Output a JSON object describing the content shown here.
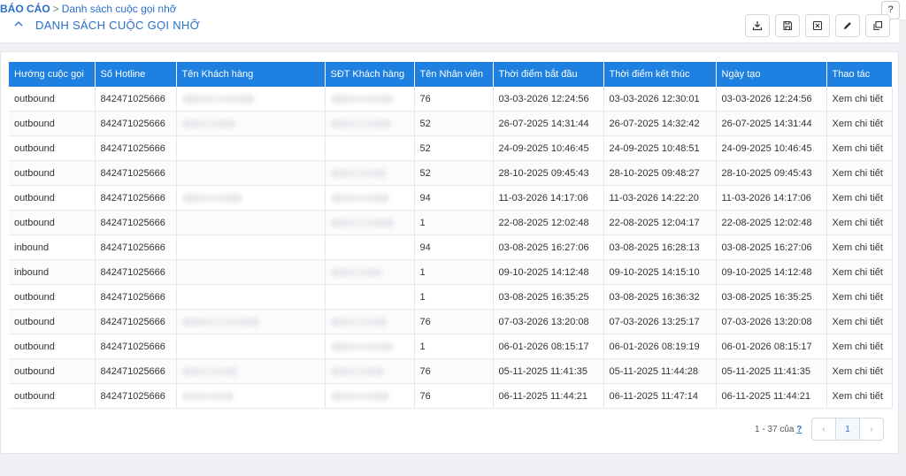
{
  "breadcrumb": {
    "root": "BÁO CÁO",
    "separator": ">",
    "current": "Danh sách cuộc gọi nhỡ"
  },
  "help": {
    "label": "?"
  },
  "section": {
    "title": "DANH SÁCH CUỘC GỌI NHỠ"
  },
  "toolbar": {
    "icons": [
      "download-icon",
      "save-icon",
      "excel-icon",
      "edit-icon",
      "copy-icon"
    ]
  },
  "table": {
    "columns": [
      "Hướng cuộc gọi",
      "Số Hotline",
      "Tên Khách hàng",
      "SĐT Khách hàng",
      "Tên Nhân viên",
      "Thời điểm bắt đầu",
      "Thời điểm kết thúc",
      "Ngày tạo",
      "Thao tác"
    ],
    "rows": [
      {
        "direction": "outbound",
        "hotline": "842471025666",
        "agent": "76",
        "start": "03-03-2026 12:24:56",
        "end": "03-03-2026 12:30:01",
        "created": "03-03-2026 12:24:56",
        "action": "Xem chi tiết"
      },
      {
        "direction": "outbound",
        "hotline": "842471025666",
        "agent": "52",
        "start": "26-07-2025 14:31:44",
        "end": "26-07-2025 14:32:42",
        "created": "26-07-2025 14:31:44",
        "action": "Xem chi tiết"
      },
      {
        "direction": "outbound",
        "hotline": "842471025666",
        "agent": "52",
        "start": "24-09-2025 10:46:45",
        "end": "24-09-2025 10:48:51",
        "created": "24-09-2025 10:46:45",
        "action": "Xem chi tiết"
      },
      {
        "direction": "outbound",
        "hotline": "842471025666",
        "agent": "52",
        "start": "28-10-2025 09:45:43",
        "end": "28-10-2025 09:48:27",
        "created": "28-10-2025 09:45:43",
        "action": "Xem chi tiết"
      },
      {
        "direction": "outbound",
        "hotline": "842471025666",
        "agent": "94",
        "start": "11-03-2026 14:17:06",
        "end": "11-03-2026 14:22:20",
        "created": "11-03-2026 14:17:06",
        "action": "Xem chi tiết"
      },
      {
        "direction": "outbound",
        "hotline": "842471025666",
        "agent": "1",
        "start": "22-08-2025 12:02:48",
        "end": "22-08-2025 12:04:17",
        "created": "22-08-2025 12:02:48",
        "action": "Xem chi tiết"
      },
      {
        "direction": "inbound",
        "hotline": "842471025666",
        "agent": "94",
        "start": "03-08-2025 16:27:06",
        "end": "03-08-2025 16:28:13",
        "created": "03-08-2025 16:27:06",
        "action": "Xem chi tiết"
      },
      {
        "direction": "inbound",
        "hotline": "842471025666",
        "agent": "1",
        "start": "09-10-2025 14:12:48",
        "end": "09-10-2025 14:15:10",
        "created": "09-10-2025 14:12:48",
        "action": "Xem chi tiết"
      },
      {
        "direction": "outbound",
        "hotline": "842471025666",
        "agent": "1",
        "start": "03-08-2025 16:35:25",
        "end": "03-08-2025 16:36:32",
        "created": "03-08-2025 16:35:25",
        "action": "Xem chi tiết"
      },
      {
        "direction": "outbound",
        "hotline": "842471025666",
        "agent": "76",
        "start": "07-03-2026 13:20:08",
        "end": "07-03-2026 13:25:17",
        "created": "07-03-2026 13:20:08",
        "action": "Xem chi tiết"
      },
      {
        "direction": "outbound",
        "hotline": "842471025666",
        "agent": "1",
        "start": "06-01-2026 08:15:17",
        "end": "06-01-2026 08:19:19",
        "created": "06-01-2026 08:15:17",
        "action": "Xem chi tiết"
      },
      {
        "direction": "outbound",
        "hotline": "842471025666",
        "agent": "76",
        "start": "05-11-2025 11:41:35",
        "end": "05-11-2025 11:44:28",
        "created": "05-11-2025 11:41:35",
        "action": "Xem chi tiết"
      },
      {
        "direction": "outbound",
        "hotline": "842471025666",
        "agent": "76",
        "start": "06-11-2025 11:44:21",
        "end": "06-11-2025 11:47:14",
        "created": "06-11-2025 11:44:21",
        "action": "Xem chi tiết"
      }
    ]
  },
  "pagination": {
    "range": "1 - 37 của",
    "help": "?",
    "prev": "‹",
    "page": "1",
    "next": "›"
  }
}
